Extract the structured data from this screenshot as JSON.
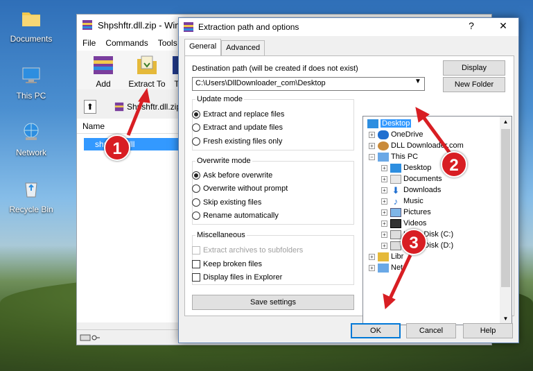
{
  "desktop": {
    "icons": [
      {
        "label": "Documents",
        "icon": "folder-icon"
      },
      {
        "label": "This PC",
        "icon": "computer-icon"
      },
      {
        "label": "Network",
        "icon": "network-icon"
      },
      {
        "label": "Recycle Bin",
        "icon": "recycle-bin-icon"
      }
    ]
  },
  "rar": {
    "title": "Shpshftr.dll.zip - Win",
    "menu": [
      "File",
      "Commands",
      "Tools"
    ],
    "toolbar": [
      {
        "label": "Add"
      },
      {
        "label": "Extract To"
      },
      {
        "label": "T"
      }
    ],
    "path": "Shpshftr.dll.zip",
    "list_header": "Name",
    "selected_file": "shpshftr.dll"
  },
  "dialog": {
    "title": "Extraction path and options",
    "help": "?",
    "close": "✕",
    "tabs": [
      "General",
      "Advanced"
    ],
    "dest_label": "Destination path (will be created if does not exist)",
    "dest_value": "C:\\Users\\DllDownloader_com\\Desktop",
    "display_btn": "Display",
    "new_folder_btn": "New Folder",
    "update_mode": {
      "legend": "Update mode",
      "options": [
        "Extract and replace files",
        "Extract and update files",
        "Fresh existing files only"
      ],
      "selected": 0
    },
    "overwrite_mode": {
      "legend": "Overwrite mode",
      "options": [
        "Ask before overwrite",
        "Overwrite without prompt",
        "Skip existing files",
        "Rename automatically"
      ],
      "selected": 0
    },
    "misc": {
      "legend": "Miscellaneous",
      "options": [
        "Extract archives to subfolders",
        "Keep broken files",
        "Display files in Explorer"
      ]
    },
    "save_settings": "Save settings",
    "tree": [
      {
        "label": "Desktop",
        "level": 0,
        "selected": true
      },
      {
        "label": "OneDrive",
        "level": 1
      },
      {
        "label": "DLL Downloader.com",
        "level": 1
      },
      {
        "label": "This PC",
        "level": 1
      },
      {
        "label": "Desktop",
        "level": 2
      },
      {
        "label": "Documents",
        "level": 2
      },
      {
        "label": "Downloads",
        "level": 2
      },
      {
        "label": "Music",
        "level": 2
      },
      {
        "label": "Pictures",
        "level": 2
      },
      {
        "label": "Videos",
        "level": 2
      },
      {
        "label": "Local Disk (C:)",
        "level": 2
      },
      {
        "label": "Local Disk (D:)",
        "level": 2
      },
      {
        "label": "Libr",
        "level": 1
      },
      {
        "label": "Net",
        "level": 1
      }
    ],
    "ok": "OK",
    "cancel": "Cancel",
    "help_btn": "Help"
  },
  "annotations": {
    "step1": "1",
    "step2": "2",
    "step3": "3",
    "color": "#d81e23"
  }
}
